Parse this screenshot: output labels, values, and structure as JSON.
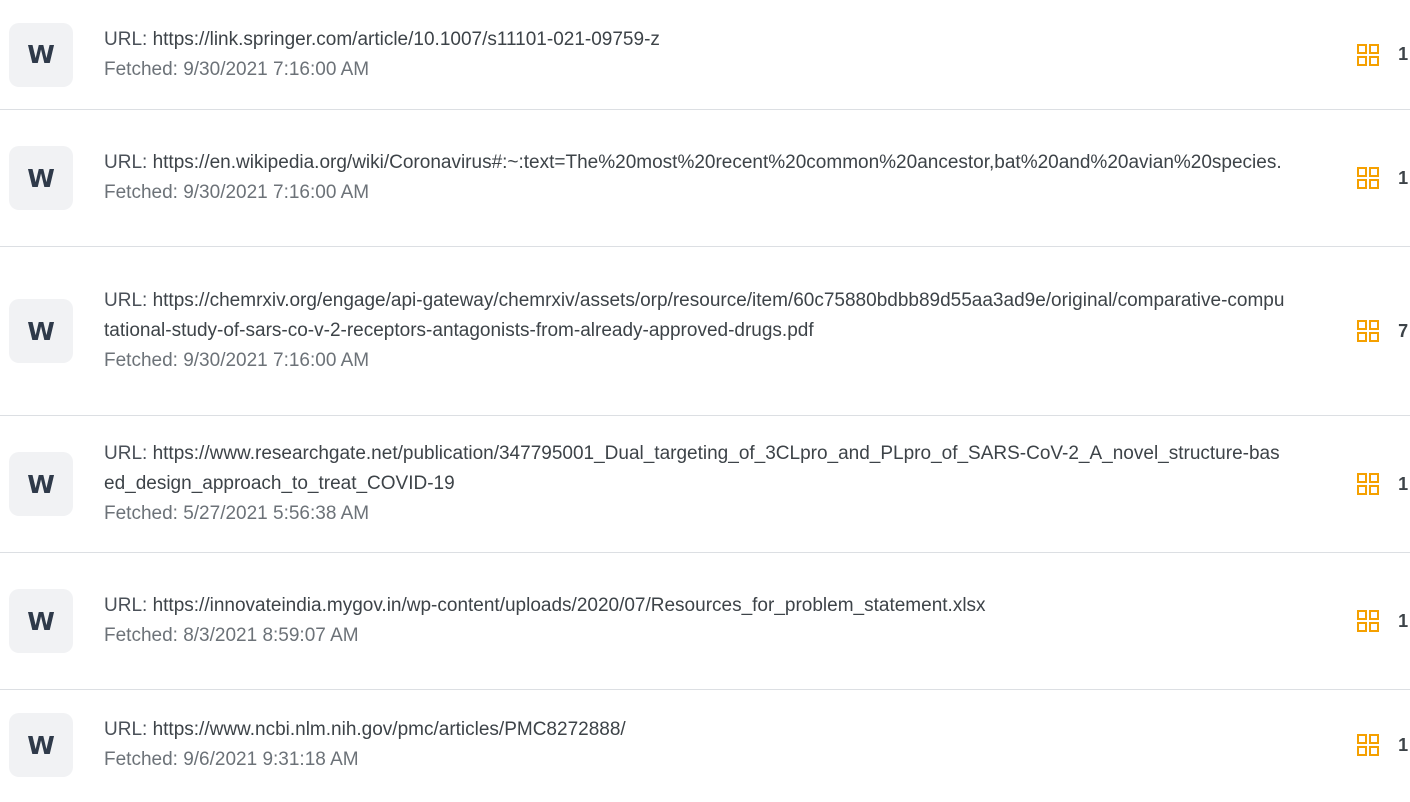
{
  "sources": [
    {
      "badge": "W",
      "url_label": "URL: ",
      "url": "https://link.springer.com/article/10.1007/s11101-021-09759-z",
      "fetched": "Fetched: 9/30/2021 7:16:00 AM",
      "count": "1"
    },
    {
      "badge": "W",
      "url_label": "URL: ",
      "url": "https://en.wikipedia.org/wiki/Coronavirus#:~:text=The%20most%20recent%20common%20ancestor,bat%20and%20avian%20species.",
      "fetched": "Fetched: 9/30/2021 7:16:00 AM",
      "count": "1"
    },
    {
      "badge": "W",
      "url_label": "URL: ",
      "url": "https://chemrxiv.org/engage/api-gateway/chemrxiv/assets/orp/resource/item/60c75880bdbb89d55aa3ad9e/original/comparative-computational-study-of-sars-co-v-2-receptors-antagonists-from-already-approved-drugs.pdf",
      "fetched": "Fetched: 9/30/2021 7:16:00 AM",
      "count": "7"
    },
    {
      "badge": "W",
      "url_label": "URL: ",
      "url": "https://www.researchgate.net/publication/347795001_Dual_targeting_of_3CLpro_and_PLpro_of_SARS-CoV-2_A_novel_structure-based_design_approach_to_treat_COVID-19",
      "fetched": "Fetched: 5/27/2021 5:56:38 AM",
      "count": "1"
    },
    {
      "badge": "W",
      "url_label": "URL: ",
      "url": "https://innovateindia.mygov.in/wp-content/uploads/2020/07/Resources_for_problem_statement.xlsx",
      "fetched": "Fetched: 8/3/2021 8:59:07 AM",
      "count": "1"
    },
    {
      "badge": "W",
      "url_label": "URL: ",
      "url": "https://www.ncbi.nlm.nih.gov/pmc/articles/PMC8272888/",
      "fetched": "Fetched: 9/6/2021 9:31:18 AM",
      "count": "1"
    }
  ],
  "colors": {
    "accent_orange": "#f5a000",
    "badge_bg": "#f1f2f4",
    "divider": "#dcdfe3"
  },
  "icons": {
    "badge": "web-source-badge-icon",
    "grid": "grid-view-icon"
  }
}
